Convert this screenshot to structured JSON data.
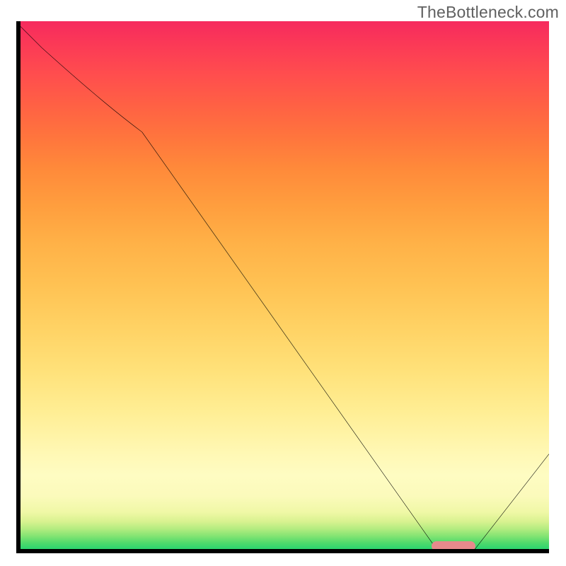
{
  "watermark": "TheBottleneck.com",
  "colors": {
    "axis": "#000000",
    "curve": "#000000",
    "marker": "#e78a8c",
    "gradient_top": "#f62a5e",
    "gradient_bottom": "#2bd46e"
  },
  "chart_data": {
    "type": "line",
    "title": "",
    "xlabel": "",
    "ylabel": "",
    "x": [
      0,
      4,
      23,
      78,
      81,
      86,
      100
    ],
    "values": [
      99,
      95,
      79,
      1,
      0,
      0,
      18
    ],
    "ylim": [
      0,
      100
    ],
    "xlim": [
      0,
      100
    ],
    "marker_x_range": [
      78,
      86
    ],
    "legend": false,
    "grid": false,
    "annotations": []
  }
}
